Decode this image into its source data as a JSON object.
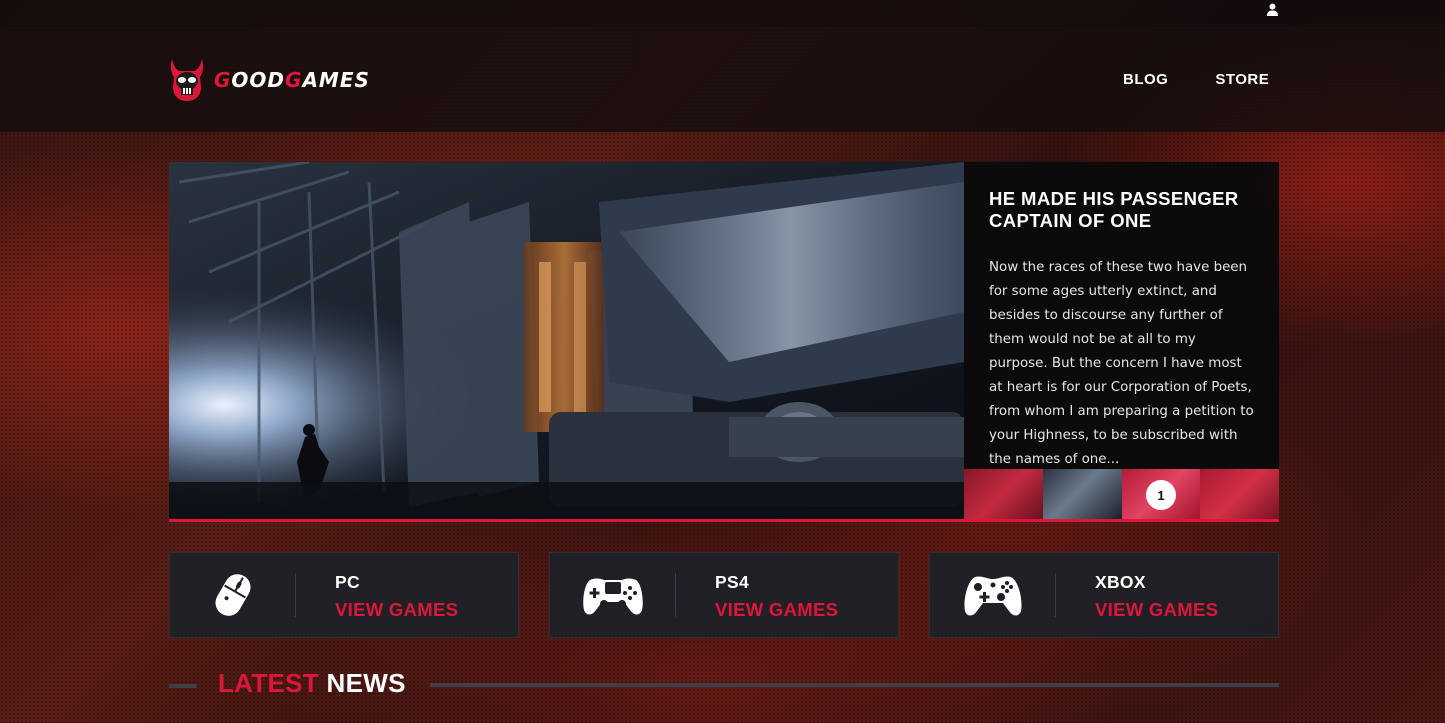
{
  "header": {
    "logo": {
      "highlight_1": "G",
      "part_1": "OOD",
      "highlight_2": "G",
      "part_2": "AMES"
    },
    "user_icon": "user-icon",
    "nav": [
      {
        "label": "BLOG"
      },
      {
        "label": "STORE"
      }
    ]
  },
  "slider": {
    "title": "HE MADE HIS PASSENGER CAPTAIN OF ONE",
    "text": "Now the races of these two have been for some ages utterly extinct, and besides to discourse any further of them would not be at all to my purpose. But the concern I have most at heart is for our Corporation of Poets, from whom I am preparing a petition to your Highness, to be subscribed with the names of one...",
    "active_thumb_number": "1"
  },
  "platforms": [
    {
      "name": "PC",
      "link": "VIEW GAMES",
      "icon": "mouse-icon"
    },
    {
      "name": "PS4",
      "link": "VIEW GAMES",
      "icon": "ps4-gamepad-icon"
    },
    {
      "name": "XBOX",
      "link": "VIEW GAMES",
      "icon": "xbox-gamepad-icon"
    }
  ],
  "latest_news": {
    "part_red": "LATEST",
    "part_white": "NEWS"
  },
  "colors": {
    "accent": "#dd163b",
    "panel": "#1e2026",
    "nav_bg": "#120e0e"
  }
}
